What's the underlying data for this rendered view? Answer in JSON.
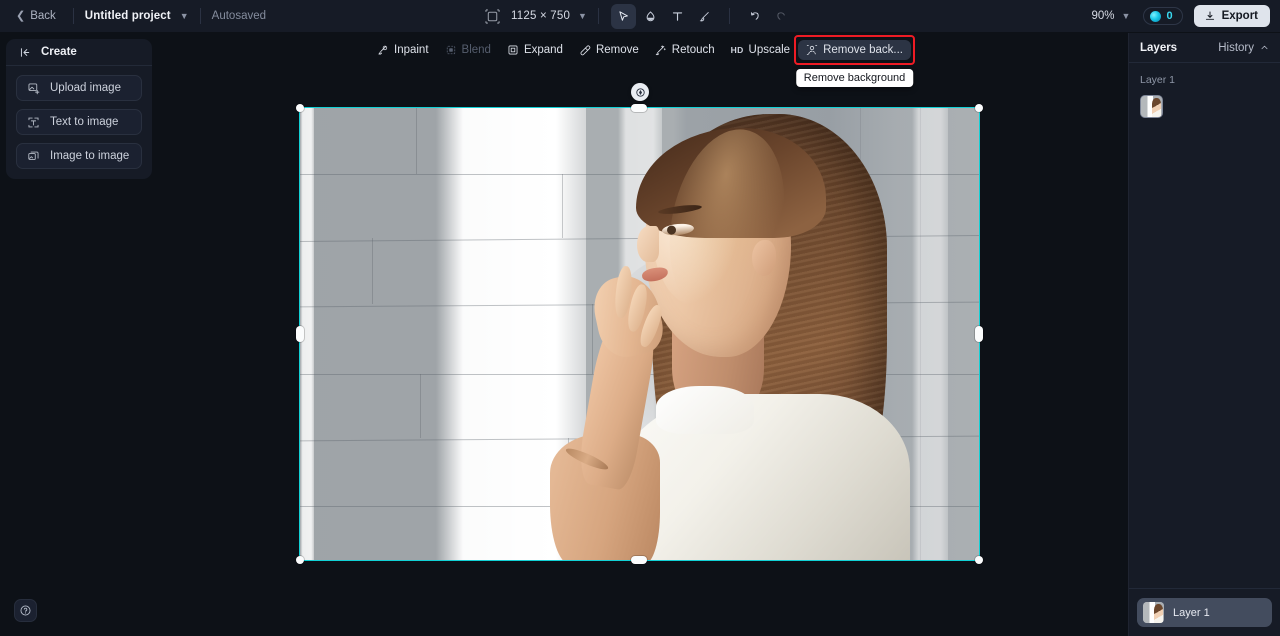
{
  "topbar": {
    "back_label": "Back",
    "project_name": "Untitled project",
    "autosaved_label": "Autosaved",
    "canvas_size": "1125 × 750",
    "zoom_level": "90%",
    "credits_count": "0",
    "export_label": "Export",
    "tools": [
      {
        "name": "select-tool",
        "glyph": "cursor",
        "active": true
      },
      {
        "name": "shape-tool",
        "glyph": "blob",
        "active": false
      },
      {
        "name": "text-tool",
        "glyph": "T",
        "active": false
      },
      {
        "name": "brush-tool",
        "glyph": "brush",
        "active": false
      },
      {
        "name": "undo-tool",
        "glyph": "undo",
        "active": false
      },
      {
        "name": "redo-tool",
        "glyph": "redo",
        "active": false
      }
    ]
  },
  "sidebar": {
    "title": "Create",
    "items": [
      {
        "label": "Upload image",
        "icon": "upload-image-icon"
      },
      {
        "label": "Text to image",
        "icon": "text-to-image-icon"
      },
      {
        "label": "Image to image",
        "icon": "image-to-image-icon"
      }
    ]
  },
  "help": {
    "icon": "help-circle-icon"
  },
  "floatbar": {
    "items": [
      {
        "label": "Inpaint",
        "icon": "inpaint-icon",
        "disabled": false,
        "highlighted": false
      },
      {
        "label": "Blend",
        "icon": "blend-icon",
        "disabled": true,
        "highlighted": false
      },
      {
        "label": "Expand",
        "icon": "expand-icon",
        "disabled": false,
        "highlighted": false
      },
      {
        "label": "Remove",
        "icon": "remove-icon",
        "disabled": false,
        "highlighted": false
      },
      {
        "label": "Retouch",
        "icon": "retouch-icon",
        "disabled": false,
        "highlighted": false
      },
      {
        "label": "Upscale",
        "icon": "hd-upscale-icon",
        "badge": "HD",
        "disabled": false,
        "highlighted": false
      },
      {
        "label": "Remove back...",
        "icon": "remove-background-icon",
        "disabled": false,
        "highlighted": true
      }
    ],
    "tooltip": "Remove background",
    "highlight_color": "#ee1b24"
  },
  "canvas": {
    "selection_color": "#12d1d6",
    "rotate_icon": "rotate-icon",
    "image_alt": "Woman in profile with long brown hair and white sleeveless top against a sunlit white brick wall"
  },
  "right_panel": {
    "tab_label": "Layers",
    "history_label": "History",
    "history_chevron": "chevron-up-icon",
    "history_group_label": "Layer 1",
    "layers": [
      {
        "name": "Layer 1",
        "selected": true
      }
    ]
  }
}
